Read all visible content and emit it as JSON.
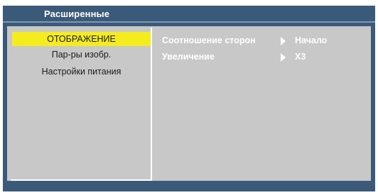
{
  "tab": {
    "title": "Расширенные"
  },
  "menu": {
    "items": [
      {
        "label": "ОТОБРАЖЕНИЕ",
        "selected": true
      },
      {
        "label": "Пар-ры изобр.",
        "selected": false
      },
      {
        "label": "Настройки питания",
        "selected": false
      }
    ]
  },
  "settings": {
    "rows": [
      {
        "label": "Соотношение сторон",
        "value": "Начало"
      },
      {
        "label": "Увеличение",
        "value": "X3"
      }
    ]
  },
  "colors": {
    "background": "#3b5a7a",
    "panel": "#c8c8c8",
    "highlight": "#f4ec1c",
    "text_light": "#ffffff",
    "text_dark": "#1a1a1a"
  },
  "icons": {
    "row_arrow": "triangle-right-icon"
  }
}
